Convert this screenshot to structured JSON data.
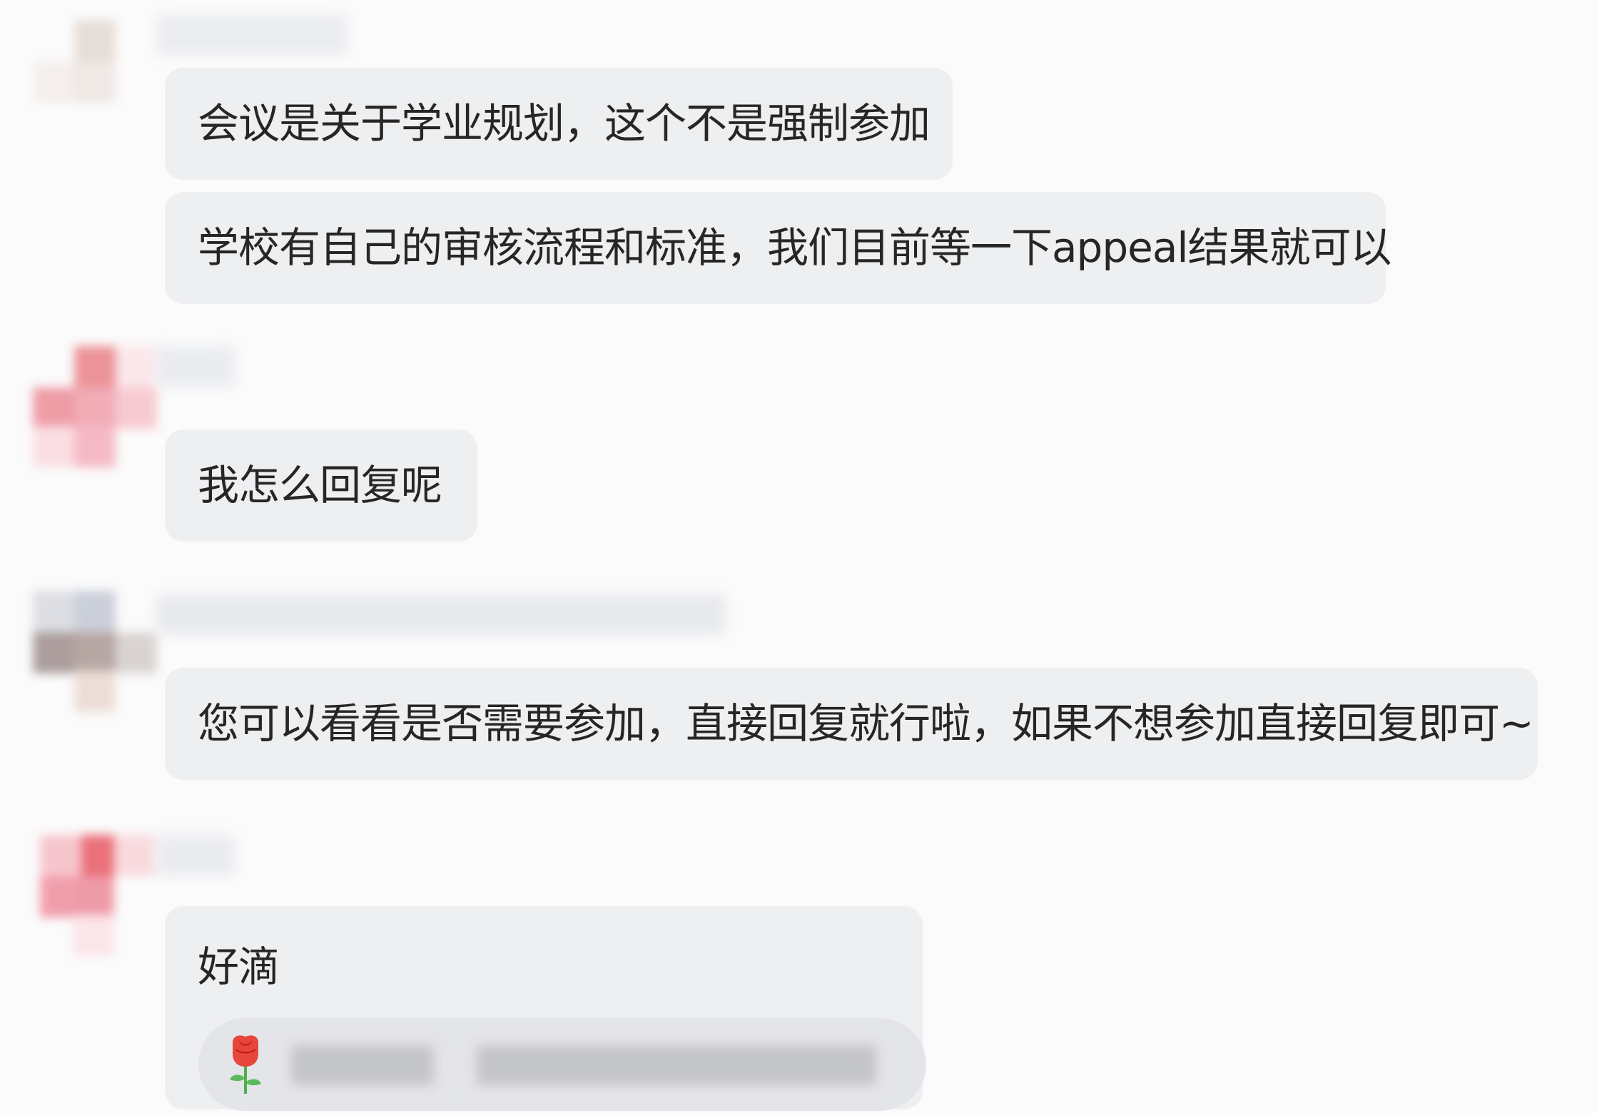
{
  "chat": {
    "messages": [
      {
        "sender": "other",
        "text": "会议是关于学业规划，这个不是强制参加"
      },
      {
        "sender": "other",
        "text": "学校有自己的审核流程和标准，我们目前等一下appeal结果就可以"
      },
      {
        "sender": "me",
        "text": "我怎么回复呢"
      },
      {
        "sender": "other",
        "text": "您可以看看是否需要参加，直接回复就行啦，如果不想参加直接回复即可~"
      },
      {
        "sender": "me",
        "text": "好滴",
        "quote_icon": "rose-emoji-icon"
      }
    ]
  },
  "colors": {
    "background": "#fbfbfb",
    "bubble": "#eeeff1",
    "quote_pill": "#e4e5e8",
    "avatar_pink": "#ee8a93"
  }
}
